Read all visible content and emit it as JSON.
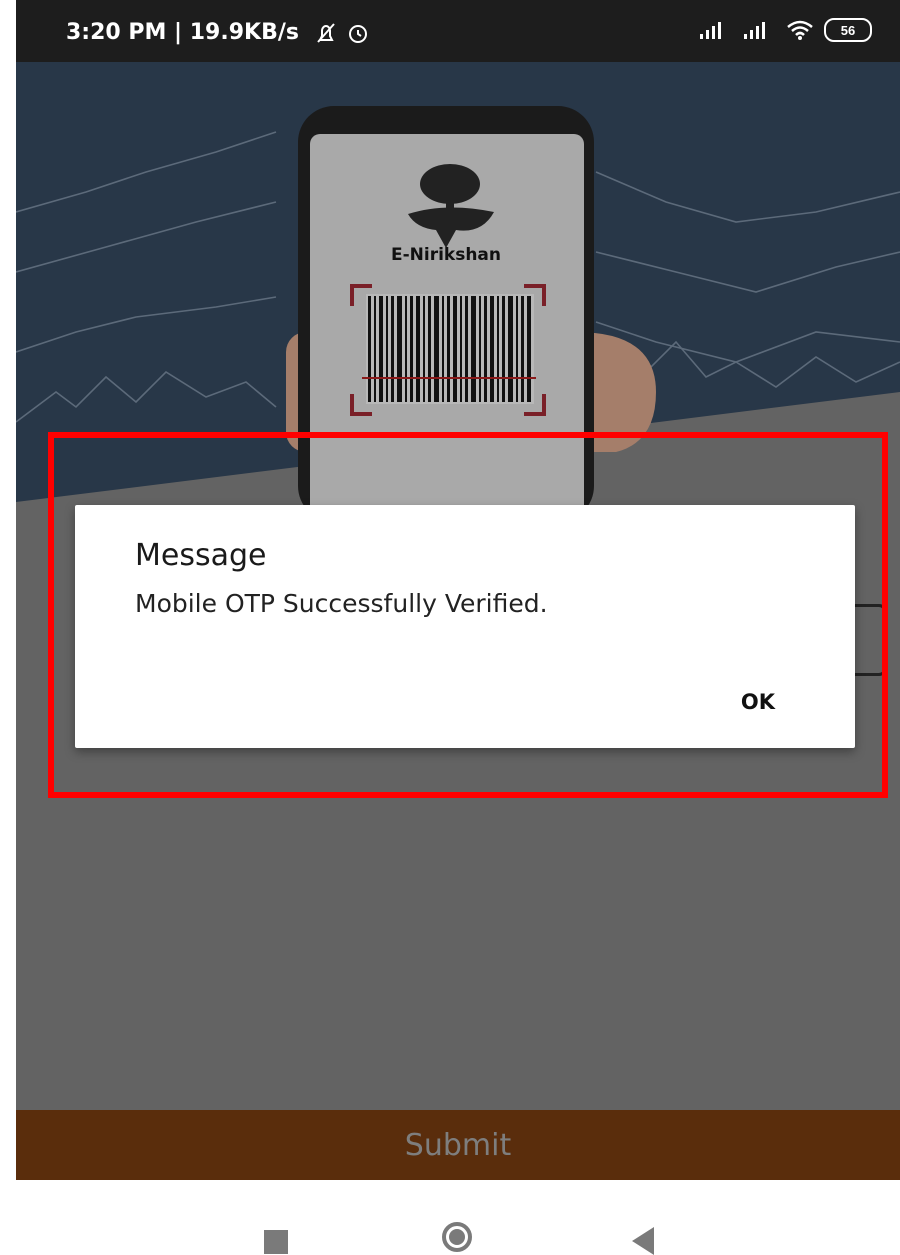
{
  "status_bar": {
    "text": "3:20 PM | 19.9KB/s",
    "battery": "56",
    "icons": [
      "notification-off-icon",
      "alarm-icon",
      "signal-icon",
      "signal-icon",
      "wifi-icon",
      "battery-icon"
    ]
  },
  "hero": {
    "app_name": "E-Nirikshan",
    "icons": [
      "tree-logo-icon",
      "barcode-icon"
    ]
  },
  "dialog": {
    "title": "Message",
    "message": "Mobile OTP Successfully Verified.",
    "ok_label": "OK"
  },
  "submit": {
    "label": "Submit"
  },
  "colors": {
    "highlight": "#ff0000",
    "submit_bar": "#5a2d0c",
    "overlay": "#636363"
  },
  "nav": {
    "icons": [
      "recent-apps-icon",
      "home-icon",
      "back-icon"
    ]
  }
}
